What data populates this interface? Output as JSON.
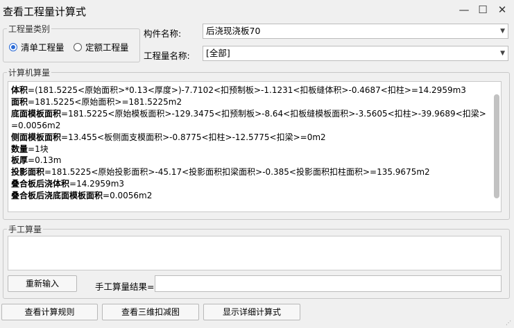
{
  "window": {
    "title": "查看工程量计算式",
    "minimize": "—",
    "maximize": "☐",
    "close": "✕"
  },
  "category": {
    "legend": "工程量类别",
    "options": [
      {
        "label": "清单工程量",
        "selected": true
      },
      {
        "label": "定额工程量",
        "selected": false
      }
    ]
  },
  "component": {
    "label": "构件名称:",
    "value": "后浇现浇板70"
  },
  "quantity": {
    "label": "工程量名称:",
    "value": "[全部]"
  },
  "computer": {
    "legend": "计算机算量",
    "lines": [
      {
        "name": "体积",
        "expr": "=(181.5225<原始面积>*0.13<厚度>)-7.7102<扣预制板>-1.1231<扣板缝体积>-0.4687<扣柱>=14.2959m3"
      },
      {
        "name": "面积",
        "expr": "=181.5225<原始面积>=181.5225m2"
      },
      {
        "name": "底面模板面积",
        "expr": "=181.5225<原始模板面积>-129.3475<扣预制板>-8.64<扣板缝模板面积>-3.5605<扣柱>-39.9689<扣梁>=0.0056m2"
      },
      {
        "name": "侧面模板面积",
        "expr": "=13.455<板侧面支模面积>-0.8775<扣柱>-12.5775<扣梁>=0m2"
      },
      {
        "name": "数量",
        "expr": "=1块"
      },
      {
        "name": "板厚",
        "expr": "=0.13m"
      },
      {
        "name": "投影面积",
        "expr": "=181.5225<原始投影面积>-45.17<投影面积扣梁面积>-0.385<投影面积扣柱面积>=135.9675m2"
      },
      {
        "name": "叠合板后浇体积",
        "expr": "=14.2959m3"
      },
      {
        "name": "叠合板后浇底面模板面积",
        "expr": "=0.0056m2"
      }
    ]
  },
  "manual": {
    "legend": "手工算量",
    "reinput": "重新输入",
    "result_label": "手工算量结果="
  },
  "bottom": {
    "rules": "查看计算规则",
    "view3d": "查看三维扣减图",
    "detail": "显示详细计算式"
  }
}
